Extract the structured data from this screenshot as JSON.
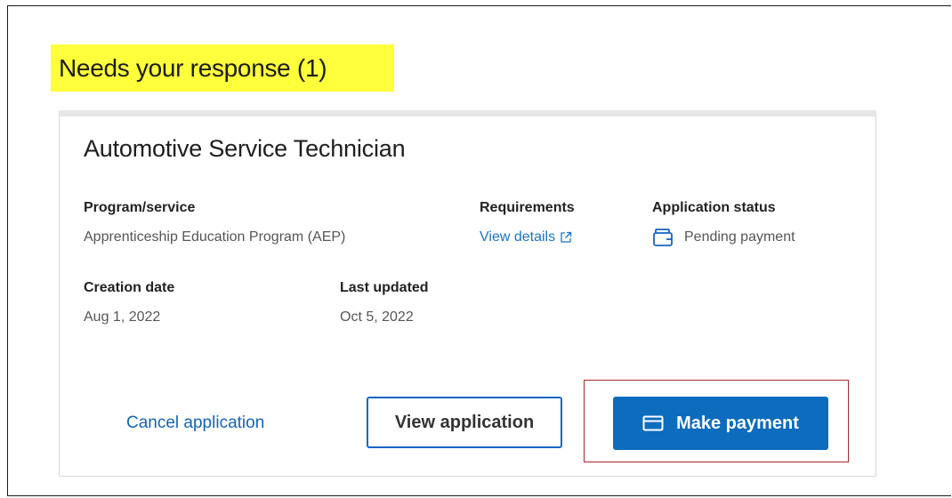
{
  "section": {
    "heading": "Needs your response (1)"
  },
  "card": {
    "title": "Automotive Service Technician",
    "program_label": "Program/service",
    "program_value": "Apprenticeship Education Program (AEP)",
    "requirements_label": "Requirements",
    "requirements_link": "View details",
    "status_label": "Application status",
    "status_value": "Pending payment",
    "creation_label": "Creation date",
    "creation_value": "Aug 1, 2022",
    "updated_label": "Last updated",
    "updated_value": "Oct 5, 2022"
  },
  "actions": {
    "cancel_label": "Cancel application",
    "view_label": "View application",
    "pay_label": "Make payment"
  },
  "icons": {
    "external": "external-link-icon",
    "wallet": "wallet-icon",
    "card": "credit-card-icon"
  },
  "colors": {
    "highlight": "#ffff3c",
    "primary": "#0d6cbd",
    "link": "#1a73c7",
    "annotation": "#a32a2a"
  }
}
